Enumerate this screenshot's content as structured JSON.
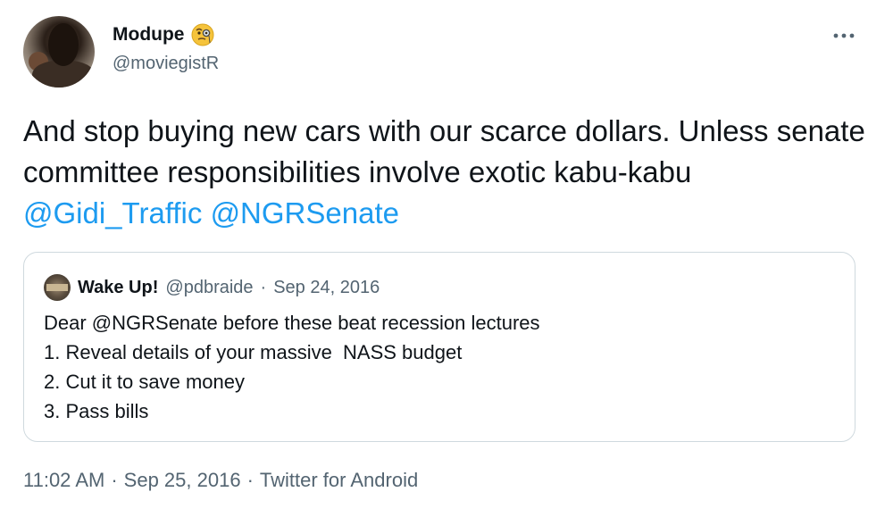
{
  "author": {
    "display_name": "Modupe",
    "emoji_icon": "face-with-monocle-icon",
    "handle": "@moviegistR"
  },
  "tweet": {
    "text_plain": "And stop buying new cars with our scarce dollars. Unless senate committee responsibilities involve exotic kabu-kabu ",
    "mentions": [
      "@Gidi_Traffic",
      "@NGRSenate"
    ]
  },
  "quoted_tweet": {
    "display_name": "Wake Up!",
    "handle": "@pdbraide",
    "date": "Sep 24, 2016",
    "separator": "·",
    "lines": [
      "Dear @NGRSenate before these beat recession lectures",
      "1. Reveal details of your massive  NASS budget",
      "2. Cut it to save money",
      "3. Pass bills"
    ]
  },
  "meta": {
    "time": "11:02 AM",
    "date": "Sep 25, 2016",
    "source": "Twitter for Android",
    "separator": "·"
  },
  "colors": {
    "link": "#1d9bf0",
    "secondary_text": "#536471",
    "primary_text": "#0f1419",
    "border": "#cfd9de"
  }
}
